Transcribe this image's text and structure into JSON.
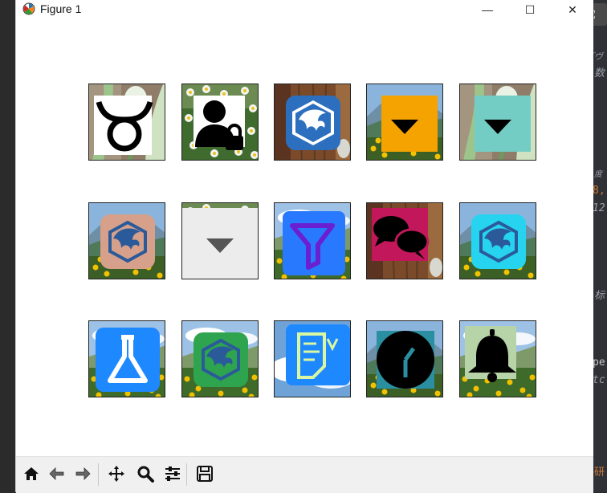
{
  "window": {
    "title": "Figure 1",
    "minimize_glyph": "—",
    "maximize_glyph": "☐",
    "close_glyph": "✕",
    "title_icon": "matplotlib-icon"
  },
  "editor_fragments": [
    {
      "text": "゙ヴ",
      "color": "#9aa0a6"
    },
    {
      "text": "数",
      "color": "#9aa0a6"
    },
    {
      "text": "度",
      "color": "#9aa0a6"
    },
    {
      "text": "8,",
      "color": "#cc7832"
    },
    {
      "text": "12",
      "color": "#9aa0a6"
    },
    {
      "text": "标",
      "color": "#9aa0a6"
    },
    {
      "text": "pe",
      "color": "#c8c8c8"
    },
    {
      "text": "tc",
      "color": "#9aa0a6"
    },
    {
      "text": "研",
      "color": "#cc7832"
    }
  ],
  "expand_glyph": "⛶",
  "tiles": [
    {
      "icon": "taurus-icon",
      "bg": "tulip",
      "accent": "#ffffff"
    },
    {
      "icon": "user-lock-icon",
      "bg": "daisy",
      "accent": "#ffffff"
    },
    {
      "icon": "eagle-icon",
      "bg": "wood",
      "accent": "#2c6fbf"
    },
    {
      "icon": "caret-down-icon",
      "bg": "mountain",
      "accent": "#f5a300"
    },
    {
      "icon": "caret-down-icon",
      "bg": "tulip",
      "accent": "#74cdc4"
    },
    {
      "icon": "eagle-icon",
      "bg": "mountain",
      "accent": "#d6a08a"
    },
    {
      "icon": "caret-down-icon",
      "bg": "daisy",
      "accent": "#ececec"
    },
    {
      "icon": "filter-icon",
      "bg": "meadow",
      "accent": "#2979ff"
    },
    {
      "icon": "chat-bubbles-icon",
      "bg": "wood",
      "accent": "#c2185b"
    },
    {
      "icon": "eagle-icon",
      "bg": "mountain",
      "accent": "#26d4f0"
    },
    {
      "icon": "flask-icon",
      "bg": "meadow",
      "accent": "#1e88ff"
    },
    {
      "icon": "eagle-icon",
      "bg": "meadow",
      "accent": "#2ea44f"
    },
    {
      "icon": "signature-doc-icon",
      "bg": "sky",
      "accent": "#1e88ff"
    },
    {
      "icon": "clock-icon",
      "bg": "mountain",
      "accent": "#2a8fa0"
    },
    {
      "icon": "bell-icon",
      "bg": "meadow",
      "accent": "#b7d3a8"
    }
  ],
  "toolbar": [
    {
      "name": "home-button",
      "icon": "home-icon"
    },
    {
      "name": "back-button",
      "icon": "arrow-left-icon"
    },
    {
      "name": "forward-button",
      "icon": "arrow-right-icon"
    },
    {
      "name": "pan-button",
      "icon": "move-icon"
    },
    {
      "name": "zoom-button",
      "icon": "magnifier-icon"
    },
    {
      "name": "configure-subplots-button",
      "icon": "sliders-icon"
    },
    {
      "name": "save-button",
      "icon": "floppy-icon"
    }
  ]
}
